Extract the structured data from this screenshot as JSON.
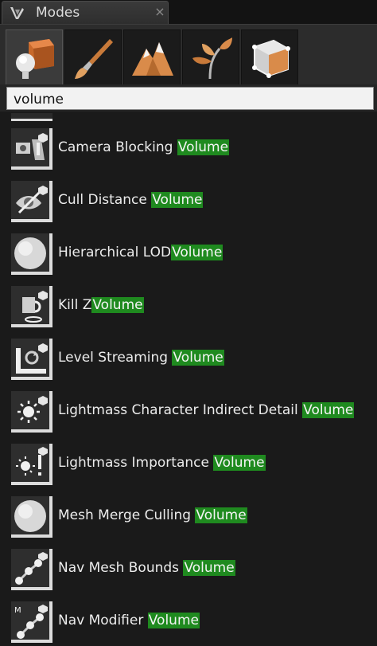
{
  "panel": {
    "title": "Modes",
    "close_symbol": "×"
  },
  "mode_tabs": [
    {
      "icon": "place-mode-icon",
      "active": true
    },
    {
      "icon": "paint-mode-icon",
      "active": false
    },
    {
      "icon": "landscape-mode-icon",
      "active": false
    },
    {
      "icon": "foliage-mode-icon",
      "active": false
    },
    {
      "icon": "geometry-edit-mode-icon",
      "active": false
    }
  ],
  "search": {
    "value": "volume"
  },
  "items": [
    {
      "prefix": "Camera Blocking ",
      "match": "Volume",
      "icon": "camera-blocking-icon"
    },
    {
      "prefix": "Cull Distance ",
      "match": "Volume",
      "icon": "cull-distance-icon"
    },
    {
      "prefix": "Hierarchical LOD",
      "match": "Volume",
      "icon": "sphere-icon"
    },
    {
      "prefix": "Kill Z",
      "match": "Volume",
      "icon": "kill-z-icon"
    },
    {
      "prefix": "Level Streaming ",
      "match": "Volume",
      "icon": "level-streaming-icon"
    },
    {
      "prefix": "Lightmass Character Indirect Detail ",
      "match": "Volume",
      "icon": "sun-icon"
    },
    {
      "prefix": "Lightmass Importance ",
      "match": "Volume",
      "icon": "lightmass-importance-icon"
    },
    {
      "prefix": "Mesh Merge Culling ",
      "match": "Volume",
      "icon": "sphere-icon"
    },
    {
      "prefix": "Nav Mesh Bounds ",
      "match": "Volume",
      "icon": "nav-mesh-icon"
    },
    {
      "prefix": "Nav Modifier ",
      "match": "Volume",
      "icon": "nav-modifier-icon"
    }
  ],
  "colors": {
    "highlight": "#1f8a1f",
    "panel_bg": "#1a1a1a",
    "search_bg": "#f2f2f2"
  }
}
